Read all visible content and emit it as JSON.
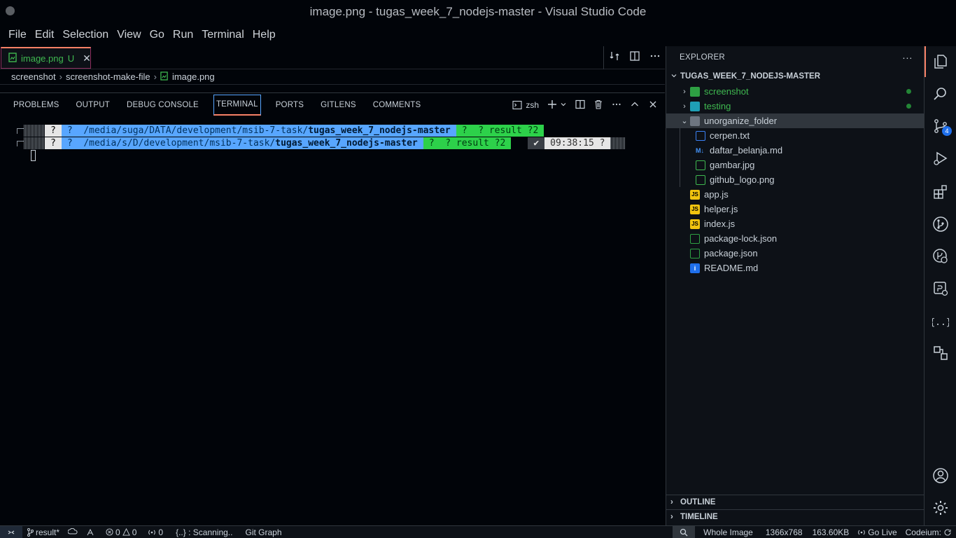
{
  "window": {
    "title": "image.png - tugas_week_7_nodejs-master - Visual Studio Code"
  },
  "menu": [
    "File",
    "Edit",
    "Selection",
    "View",
    "Go",
    "Run",
    "Terminal",
    "Help"
  ],
  "editor": {
    "tab": {
      "name": "image.png",
      "status": "U",
      "close": "✕"
    },
    "breadcrumb": [
      "screenshot",
      "screenshot-make-file",
      "image.png"
    ]
  },
  "panel": {
    "tabs": [
      "PROBLEMS",
      "OUTPUT",
      "DEBUG CONSOLE",
      "TERMINAL",
      "PORTS",
      "GITLENS",
      "COMMENTS"
    ],
    "active_tab": "TERMINAL",
    "shell": "zsh",
    "terminal": {
      "line1": {
        "os": "?",
        "lock": "?",
        "path_prefix": "/media/suga/DATA/development/msib-7-task/",
        "path_dir": "tugas_week_7_nodejs-master",
        "git": "?  ? result ?2"
      },
      "line2": {
        "os": "?",
        "lock": "?",
        "path_prefix": "/media/s/D/development/msib-7-task/",
        "path_dir": "tugas_week_7_nodejs-master",
        "git": "?  ? result ?2",
        "check": "✔",
        "time": "09:38:15 ?"
      }
    }
  },
  "explorer": {
    "header": "EXPLORER",
    "more": "···",
    "root": "TUGAS_WEEK_7_NODEJS-MASTER",
    "items": [
      {
        "name": "screenshot",
        "type": "folder",
        "level": 0,
        "expanded": false
      },
      {
        "name": "testing",
        "type": "folder",
        "level": 0,
        "expanded": false
      },
      {
        "name": "unorganize_folder",
        "type": "folder",
        "level": 0,
        "expanded": true
      },
      {
        "name": "cerpen.txt",
        "type": "file",
        "level": 1
      },
      {
        "name": "daftar_belanja.md",
        "type": "md",
        "level": 1
      },
      {
        "name": "gambar.jpg",
        "type": "img",
        "level": 1
      },
      {
        "name": "github_logo.png",
        "type": "img",
        "level": 1
      },
      {
        "name": "app.js",
        "type": "js",
        "level": 0
      },
      {
        "name": "helper.js",
        "type": "js",
        "level": 0
      },
      {
        "name": "index.js",
        "type": "js",
        "level": 0
      },
      {
        "name": "package-lock.json",
        "type": "json",
        "level": 0
      },
      {
        "name": "package.json",
        "type": "json",
        "level": 0
      },
      {
        "name": "README.md",
        "type": "info",
        "level": 0
      }
    ],
    "outline": "OUTLINE",
    "timeline": "TIMELINE"
  },
  "activity": {
    "scm_badge": "4"
  },
  "statusbar": {
    "branch": "result*",
    "errors": "0",
    "warnings": "0",
    "ports": "0",
    "scanning": "{..} : Scanning..",
    "git_graph": "Git Graph",
    "image_mode": "Whole Image",
    "dimensions": "1366x768",
    "size": "163.60KB",
    "go_live": "Go Live",
    "codeium": "Codeium:"
  },
  "colors": {
    "accent": "#f78166",
    "git_green": "#2dd14a",
    "path_blue": "#58a6ff",
    "badge_blue": "#1f6feb"
  }
}
